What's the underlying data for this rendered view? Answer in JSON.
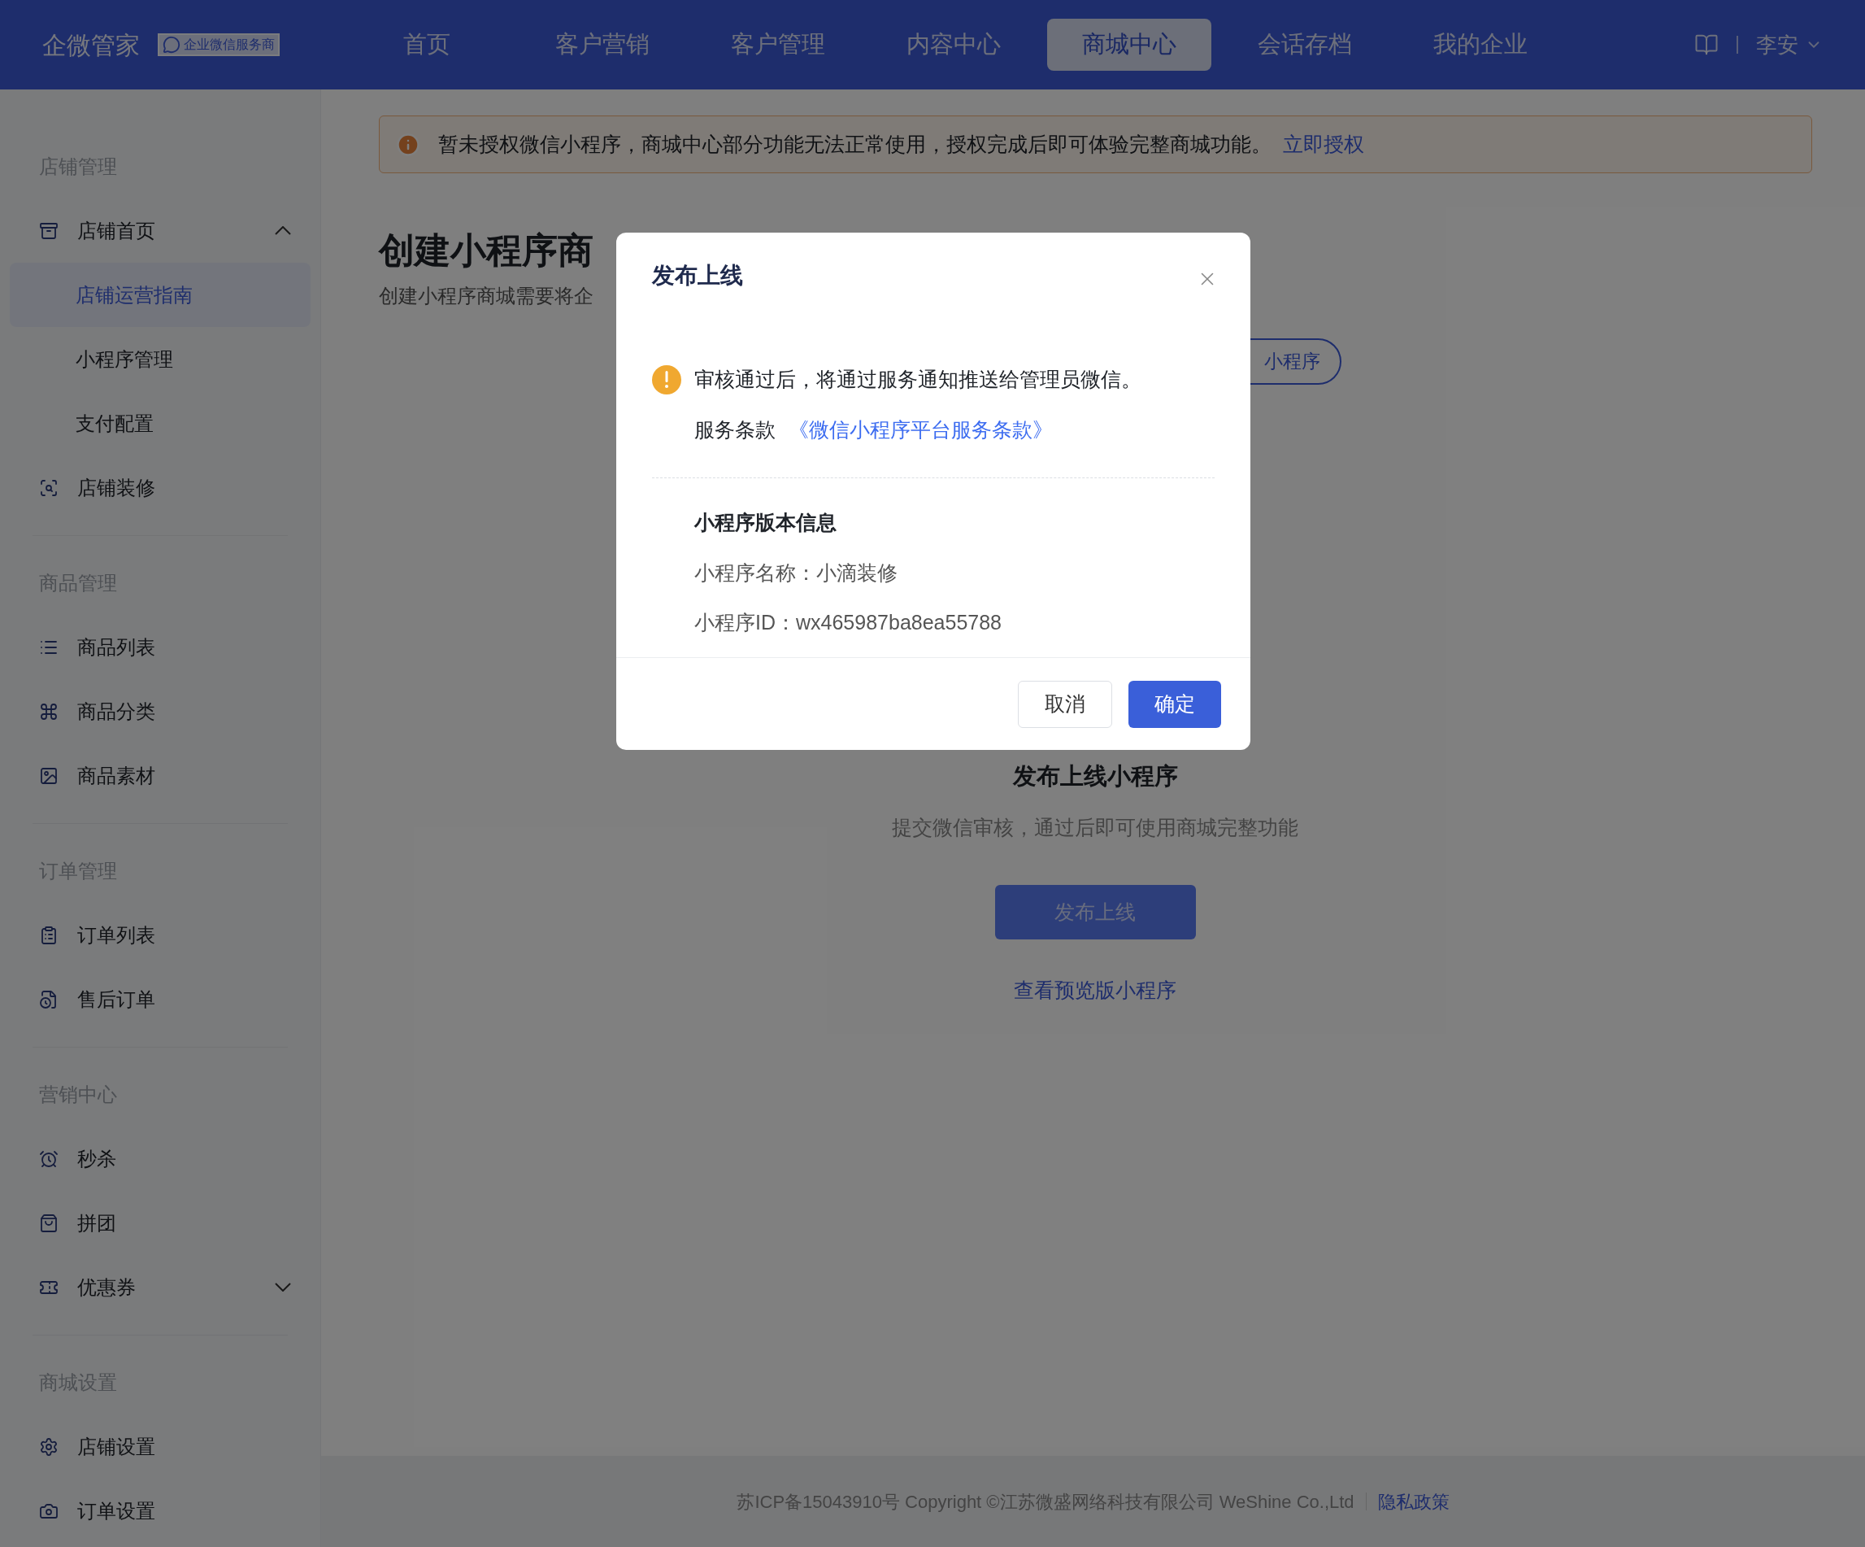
{
  "header": {
    "logo": "企微管家",
    "badge": "企业微信服务商",
    "nav": [
      {
        "label": "首页",
        "selected": false
      },
      {
        "label": "客户营销",
        "selected": false
      },
      {
        "label": "客户管理",
        "selected": false
      },
      {
        "label": "内容中心",
        "selected": false
      },
      {
        "label": "商城中心",
        "selected": true
      },
      {
        "label": "会话存档",
        "selected": false
      },
      {
        "label": "我的企业",
        "selected": false
      }
    ],
    "user": "李安"
  },
  "sidebar": {
    "sections": [
      {
        "title": "店铺管理",
        "items": [
          {
            "label": "店铺首页",
            "selected": false,
            "expanded": true,
            "children": [
              {
                "label": "店铺运营指南",
                "selected": true
              },
              {
                "label": "小程序管理",
                "selected": false
              },
              {
                "label": "支付配置",
                "selected": false
              }
            ]
          },
          {
            "label": "店铺装修",
            "selected": false
          }
        ]
      },
      {
        "title": "商品管理",
        "items": [
          {
            "label": "商品列表",
            "selected": false
          },
          {
            "label": "商品分类",
            "selected": false
          },
          {
            "label": "商品素材",
            "selected": false
          }
        ]
      },
      {
        "title": "订单管理",
        "items": [
          {
            "label": "订单列表",
            "selected": false
          },
          {
            "label": "售后订单",
            "selected": false
          }
        ]
      },
      {
        "title": "营销中心",
        "items": [
          {
            "label": "秒杀",
            "selected": false
          },
          {
            "label": "拼团",
            "selected": false
          },
          {
            "label": "优惠券",
            "selected": false,
            "expanded": false
          }
        ]
      },
      {
        "title": "商城设置",
        "items": [
          {
            "label": "店铺设置",
            "selected": false
          },
          {
            "label": "订单设置",
            "selected": false
          }
        ]
      }
    ]
  },
  "alert": {
    "text": "暂未授权微信小程序，商城中心部分功能无法正常使用，授权完成后即可体验完整商城功能。",
    "link": "立即授权"
  },
  "page": {
    "title": "创建小程序商",
    "subtitle": "创建小程序商城需要将企",
    "partial_button": "小程序"
  },
  "step": {
    "title": "发布上线小程序",
    "description": "提交微信审核，通过后即可使用商城完整功能",
    "button": "发布上线",
    "link": "查看预览版小程序"
  },
  "modal": {
    "title": "发布上线",
    "notice": "审核通过后，将通过服务通知推送给管理员微信。",
    "terms_label": "服务条款",
    "terms_link": "《微信小程序平台服务条款》",
    "info_title": "小程序版本信息",
    "info_lines": [
      "小程序名称：小滴装修",
      "小程序ID：wx465987ba8ea55788"
    ],
    "cancel": "取消",
    "confirm": "确定"
  },
  "footer": {
    "text": "苏ICP备15043910号 Copyright ©江苏微盛网络科技有限公司 WeShine Co.,Ltd",
    "link": "隐私政策"
  }
}
